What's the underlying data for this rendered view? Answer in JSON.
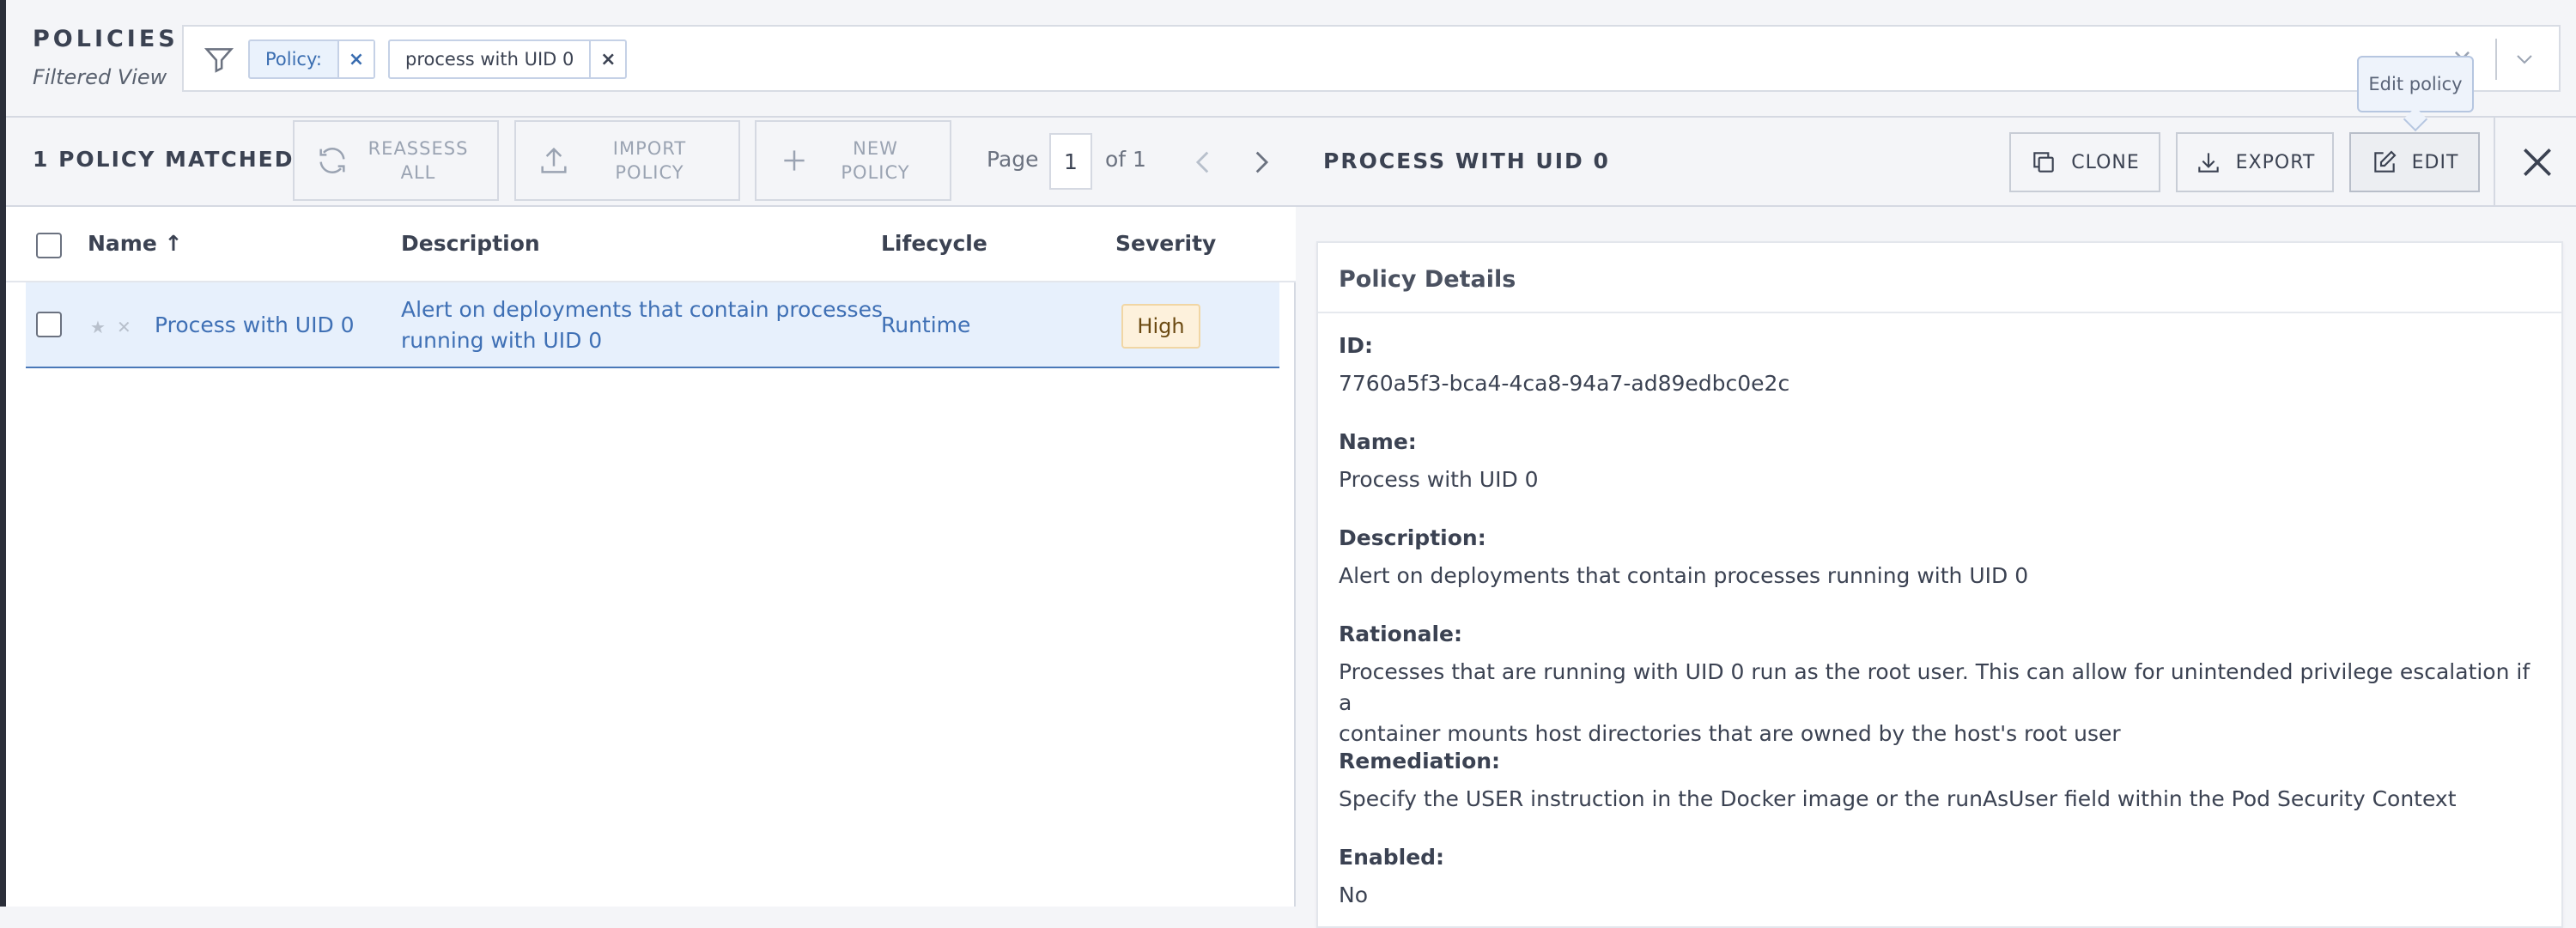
{
  "header": {
    "title": "POLICIES",
    "subtitle": "Filtered View",
    "search": {
      "chips": [
        {
          "label": "Policy:",
          "remove": "×"
        },
        {
          "label": "process with UID 0",
          "remove": "×"
        }
      ],
      "clear": "×"
    }
  },
  "list": {
    "matched": "1 POLICY MATCHED",
    "buttons": {
      "reassess": "REASSESS\nALL",
      "import": "IMPORT\nPOLICY",
      "new": "NEW\nPOLICY"
    },
    "pagination": {
      "page_label": "Page",
      "page": "1",
      "of": "of 1"
    },
    "columns": {
      "name": "Name ↑",
      "description": "Description",
      "lifecycle": "Lifecycle",
      "severity": "Severity"
    },
    "rows": [
      {
        "name": "Process with UID 0",
        "description_line1": "Alert on deployments that contain processes",
        "description_line2": "running with UID 0",
        "lifecycle": "Runtime",
        "severity": "High"
      }
    ]
  },
  "detail": {
    "title": "PROCESS WITH UID 0",
    "actions": {
      "clone": "CLONE",
      "export": "EXPORT",
      "edit": "EDIT"
    },
    "tooltip": "Edit policy",
    "card_title": "Policy Details",
    "fields": {
      "id": {
        "label": "ID:",
        "value": "7760a5f3-bca4-4ca8-94a7-ad89edbc0e2c"
      },
      "name": {
        "label": "Name:",
        "value": "Process with UID 0"
      },
      "description": {
        "label": "Description:",
        "value": "Alert on deployments that contain processes running with UID 0"
      },
      "rationale": {
        "label": "Rationale:",
        "line1": "Processes that are running with UID 0 run as the root user. This can allow for unintended privilege escalation if a",
        "line2": "container mounts host directories that are owned by the host's root user"
      },
      "remediation": {
        "label": "Remediation:",
        "value": "Specify the USER instruction in the Docker image or the runAsUser field within the Pod Security Context"
      },
      "enabled": {
        "label": "Enabled:",
        "value": "No"
      }
    }
  },
  "colors": {
    "accent": "#3f70b5",
    "row_selected": "#e7f0fc",
    "severity_high_bg": "#fdf1dc"
  }
}
